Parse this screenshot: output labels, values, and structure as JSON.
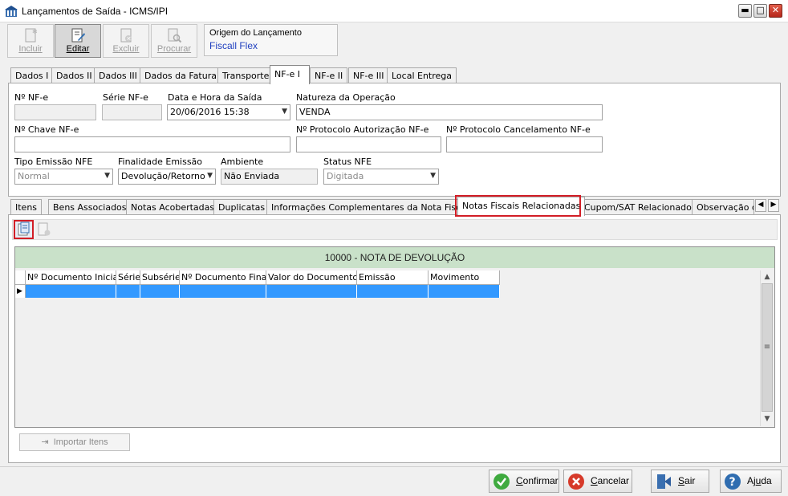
{
  "window": {
    "title": "Lançamentos de Saída - ICMS/IPI",
    "minimize_glyph": "▬",
    "maximize_glyph": "□",
    "close_glyph": "✕"
  },
  "toolbar": {
    "incluir": "Incluir",
    "editar": "Editar",
    "excluir": "Excluir",
    "procurar": "Procurar"
  },
  "origin": {
    "label": "Origem do Lançamento",
    "value": "Fiscall Flex"
  },
  "top_tabs": [
    "Dados I",
    "Dados II",
    "Dados III",
    "Dados da Fatura",
    "Transporte",
    "NF-e I",
    "NF-e II",
    "NF-e III",
    "Local Entrega"
  ],
  "form": {
    "nf_label": "Nº NF-e",
    "nf_value": "",
    "serie_label": "Série NF-e",
    "serie_value": "",
    "data_label": "Data e Hora da Saída",
    "data_value": "20/06/2016 15:38",
    "natureza_label": "Natureza da Operação",
    "natureza_value": "VENDA",
    "chave_label": "Nº Chave NF-e",
    "chave_value": "",
    "protocolo_aut_label": "Nº Protocolo Autorização NF-e",
    "protocolo_aut_value": "",
    "protocolo_canc_label": "Nº Protocolo Cancelamento NF-e",
    "protocolo_canc_value": "",
    "tipo_emissao_label": "Tipo Emissão NFE",
    "tipo_emissao_value": "Normal",
    "finalidade_label": "Finalidade Emissão",
    "finalidade_value": "Devolução/Retorno",
    "ambiente_label": "Ambiente",
    "ambiente_value": "Não Enviada",
    "status_label": "Status NFE",
    "status_value": "Digitada"
  },
  "bottom_tabs": [
    "Itens",
    "Bens Associados",
    "Notas Acobertadas",
    "Duplicatas",
    "Informações Complementares da Nota Fiscal",
    "Notas Fiscais Relacionadas",
    "Cupom/SAT Relacionados",
    "Observação de"
  ],
  "grid": {
    "header": "10000  -  NOTA DE DEVOLUÇÃO",
    "columns": [
      "Nº Documento Inicial",
      "Série",
      "Subsérie",
      "Nº Documento Final",
      "Valor do Documento",
      "Emissão",
      "Movimento"
    ]
  },
  "import_button": "Importar Itens",
  "footer": {
    "confirmar_underlined": "C",
    "confirmar_rest": "onfirmar",
    "cancelar_underlined": "C",
    "cancelar_rest": "ancelar",
    "sair_underlined": "S",
    "sair_rest": "air",
    "ajuda_prefix": "Aj",
    "ajuda_underlined": "u",
    "ajuda_rest": "da"
  },
  "colors": {
    "highlight": "#d21e26",
    "grid_header": "#c9e1c9",
    "selection": "#3399ff"
  }
}
